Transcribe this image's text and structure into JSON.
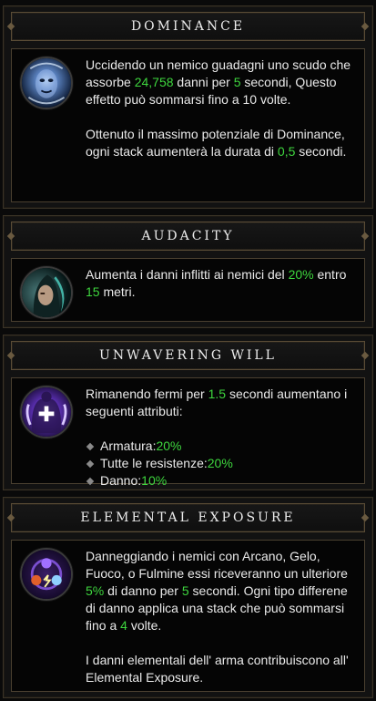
{
  "panels": {
    "dominance": {
      "title": "Dominance",
      "p1": [
        "Uccidendo un nemico guadagni uno scudo che assorbe ",
        "24,758",
        " danni per ",
        "5",
        " secondi, Questo effetto può sommarsi fino a 10 volte."
      ],
      "p2": [
        "Ottenuto il massimo potenziale di Dominance, ogni stack aumenterà la durata di ",
        "0,5",
        " secondi."
      ]
    },
    "audacity": {
      "title": "Audacity",
      "p1": [
        "Aumenta i danni inflitti ai nemici del ",
        "20%",
        " entro ",
        "15",
        " metri."
      ]
    },
    "unwavering": {
      "title": "Unwavering Will",
      "p1": [
        "Rimanendo fermi per ",
        "1.5",
        " secondi aumentano i seguenti attributi:"
      ],
      "bullets": [
        {
          "label": "Armatura: ",
          "value": "20%"
        },
        {
          "label": "Tutte le resistenze: ",
          "value": "20%"
        },
        {
          "label": "Danno: ",
          "value": "10%"
        }
      ]
    },
    "elemental": {
      "title": "Elemental Exposure",
      "p1": [
        "Danneggiando i nemici con Arcano, Gelo, Fuoco, o Fulmine essi riceveranno un ulteriore ",
        "5%",
        " di danno per ",
        "5",
        " secondi. Ogni tipo differene di danno applica una stack che può sommarsi fino a ",
        "4",
        " volte."
      ],
      "p2": [
        "I danni elementali dell' arma contribuiscono all' Elemental Exposure."
      ]
    }
  },
  "colors": {
    "highlight": "#3ed63e",
    "text": "#eaeaea",
    "frame": "#5a4c36"
  },
  "icons": {
    "dominance": "face-sigil-icon",
    "audacity": "hooded-figure-icon",
    "unwavering": "shielded-body-icon",
    "elemental": "elements-icon"
  }
}
